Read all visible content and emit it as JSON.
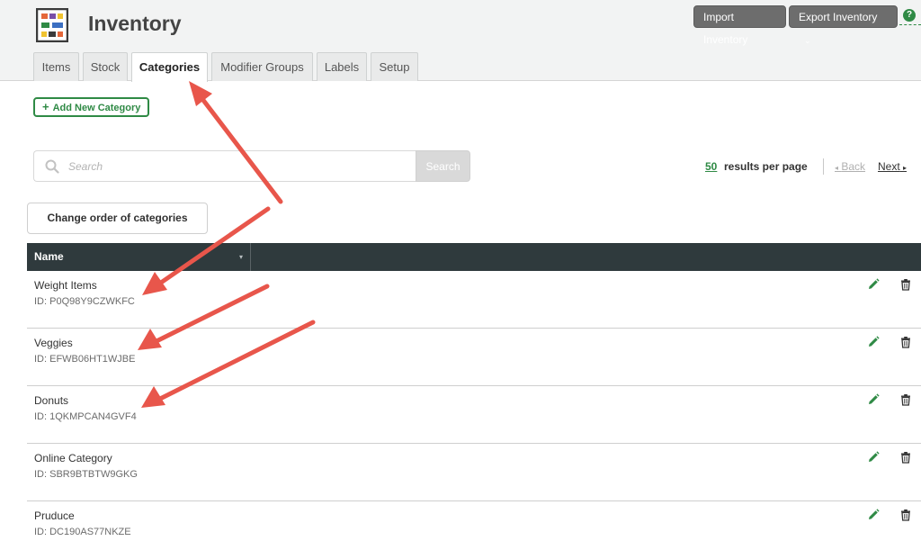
{
  "app": {
    "title": "Inventory",
    "logo_icon": "inventory-shelf-icon"
  },
  "header": {
    "import_label": "Import Inventory",
    "export_label": "Export Inventory",
    "export_chevron": "⌄",
    "help_icon": "help-circle-icon",
    "help_glyph": "?"
  },
  "tabs": [
    {
      "label": "Items",
      "active": false
    },
    {
      "label": "Stock",
      "active": false
    },
    {
      "label": "Categories",
      "active": true
    },
    {
      "label": "Modifier Groups",
      "active": false
    },
    {
      "label": "Labels",
      "active": false
    },
    {
      "label": "Setup",
      "active": false
    }
  ],
  "toolbar": {
    "add_label": "Add New Category",
    "add_glyph": "+",
    "order_label": "Change order of categories"
  },
  "search": {
    "placeholder": "Search",
    "button_label": "Search"
  },
  "pagination": {
    "per_page": "50",
    "per_page_label": "results per page",
    "back_label": "Back",
    "back_glyph": "◂",
    "next_label": "Next",
    "next_glyph": "▸"
  },
  "table": {
    "column_name": "Name",
    "sort_glyph": "▾",
    "rows": [
      {
        "name": "Weight Items",
        "id": "ID: P0Q98Y9CZWKFC"
      },
      {
        "name": "Veggies",
        "id": "ID: EFWB06HT1WJBE"
      },
      {
        "name": "Donuts",
        "id": "ID: 1QKMPCAN4GVF4"
      },
      {
        "name": "Online Category",
        "id": "ID: SBR9BTBTW9GKG"
      },
      {
        "name": "Pruduce",
        "id": "ID: DC190AS77NKZE"
      }
    ]
  },
  "colors": {
    "accent_green": "#2f8a45",
    "header_dark": "#2f3a3d",
    "annotation_red": "#e8564b"
  }
}
